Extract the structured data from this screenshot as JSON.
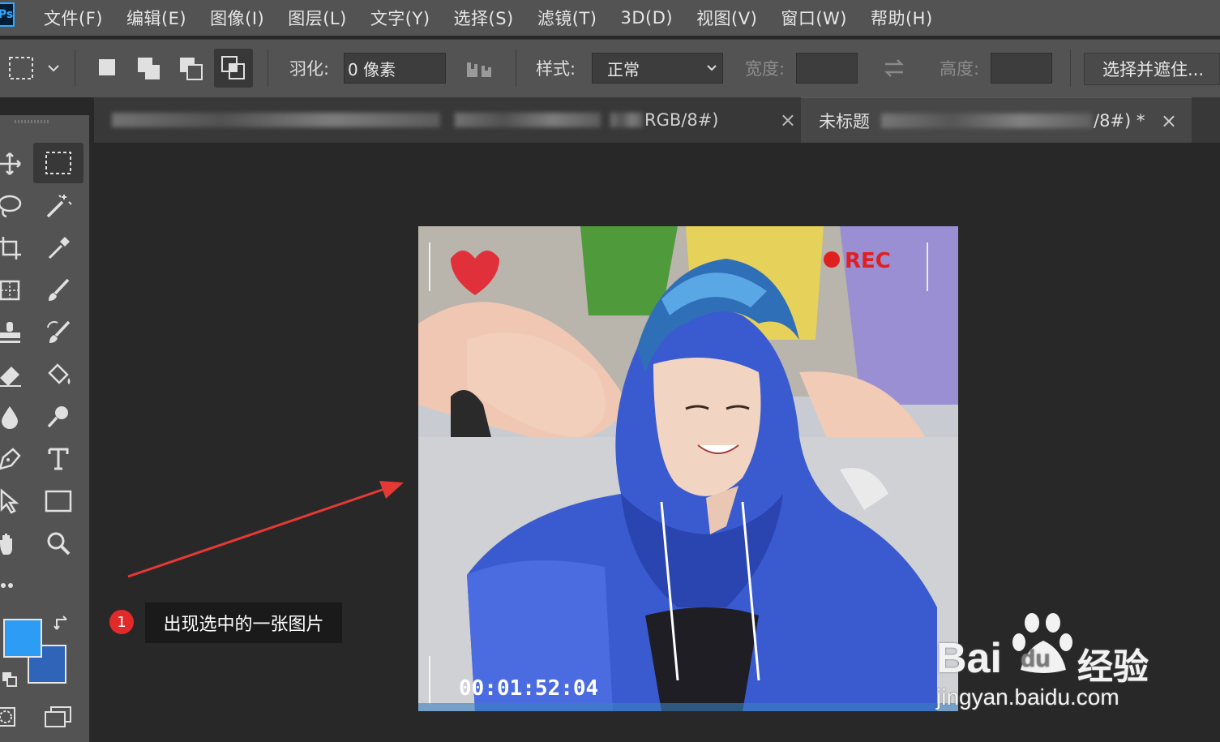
{
  "app": {
    "logo": "Ps",
    "accent": "#31a8ff"
  },
  "menu": [
    "文件(F)",
    "编辑(E)",
    "图像(I)",
    "图层(L)",
    "文字(Y)",
    "选择(S)",
    "滤镜(T)",
    "3D(D)",
    "视图(V)",
    "窗口(W)",
    "帮助(H)"
  ],
  "options": {
    "feather_label": "羽化:",
    "feather_value": "0 像素",
    "style_label": "样式:",
    "style_value": "正常",
    "width_label": "宽度:",
    "height_label": "高度:",
    "select_mask_button": "选择并遮住..."
  },
  "tabs": [
    {
      "label": "RGB/8#)",
      "close": "×"
    },
    {
      "label": "未标题",
      "suffix": "/8#) *",
      "close": "×"
    }
  ],
  "photo": {
    "rec_label": "REC",
    "timecode": "00:01:52:04"
  },
  "annotation": {
    "number": "1",
    "text": "出现选中的一张图片"
  },
  "colors": {
    "foreground": "#2d9cf5",
    "background": "#2f64b8",
    "arrow": "#e53935"
  },
  "watermark": {
    "brand_a": "Bai",
    "brand_b": "du",
    "brand_c": "经验",
    "url": "jingyan.baidu.com"
  }
}
